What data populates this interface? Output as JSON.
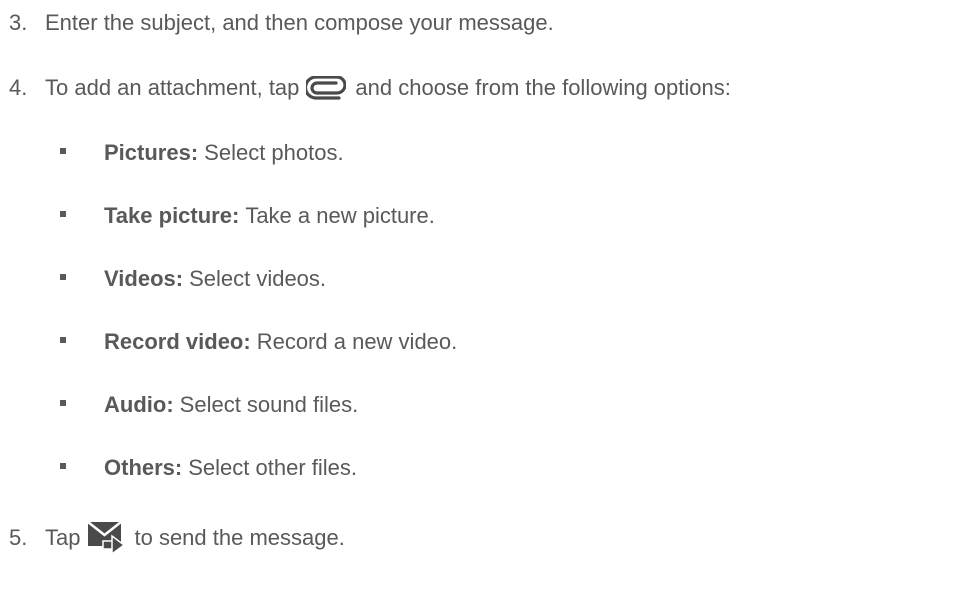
{
  "steps": {
    "s3": {
      "num": "3.",
      "text": "Enter the subject, and then compose your message."
    },
    "s4": {
      "num": "4.",
      "before": "To add an attachment, tap",
      "icon": "paperclip-icon",
      "after": "and choose from the following options:"
    },
    "s5": {
      "num": "5.",
      "before": "Tap",
      "icon": "send-message-icon",
      "after": "to send the message."
    }
  },
  "options": [
    {
      "term": "Pictures:",
      "desc": "Select photos."
    },
    {
      "term": "Take picture:",
      "desc": "Take a new picture."
    },
    {
      "term": "Videos:",
      "desc": "Select videos."
    },
    {
      "term": "Record video:",
      "desc": "Record a new video."
    },
    {
      "term": "Audio:",
      "desc": "Select sound files."
    },
    {
      "term": "Others:",
      "desc": "Select other files."
    }
  ],
  "colors": {
    "text": "#595959",
    "icon": "#4a4a4a"
  }
}
